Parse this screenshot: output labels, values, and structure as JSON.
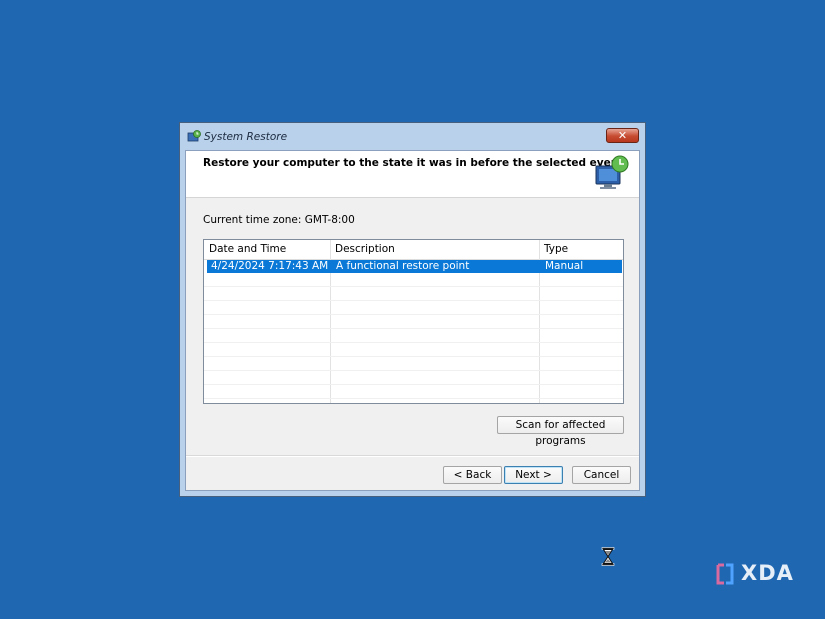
{
  "window": {
    "title": "System Restore",
    "close_label": "✕"
  },
  "header": {
    "title": "Restore your computer to the state it was in before the selected event"
  },
  "timezone_label": "Current time zone: GMT-8:00",
  "table": {
    "columns": [
      "Date and Time",
      "Description",
      "Type"
    ],
    "rows": [
      {
        "date": "4/24/2024 7:17:43 AM",
        "description": "A functional restore point",
        "type": "Manual",
        "selected": true
      }
    ]
  },
  "buttons": {
    "scan": "Scan for affected programs",
    "back": "< Back",
    "next": "Next >",
    "cancel": "Cancel"
  },
  "watermark": {
    "text": "XDA"
  },
  "colors": {
    "desktop": "#1f67b1",
    "selection": "#0a78d7",
    "close_button": "#c64b31"
  }
}
